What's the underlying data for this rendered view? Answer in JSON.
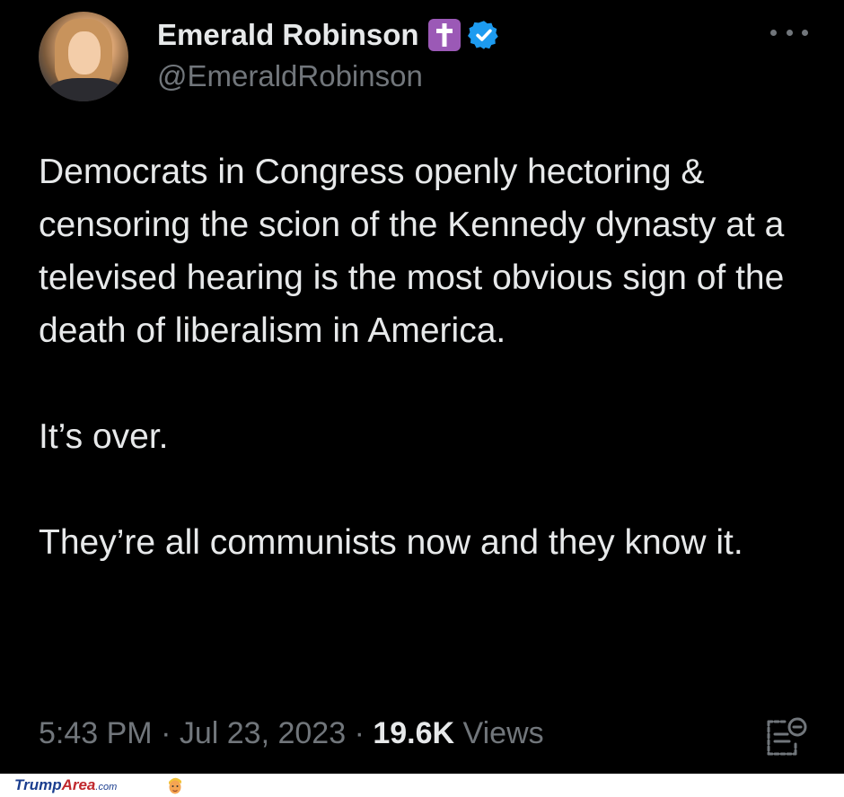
{
  "author": {
    "display_name": "Emerald Robinson",
    "handle": "@EmeraldRobinson",
    "badges": [
      "latin-cross-emoji-icon",
      "verified-badge-icon"
    ]
  },
  "tweet": {
    "paragraphs": [
      "Democrats in Congress openly hectoring & censoring the scion of the Kennedy dynasty at a televised hearing is the most obvious sign of the death of liberalism in America.",
      "It’s over.",
      "They’re all communists now and they know it."
    ],
    "time": "5:43 PM",
    "separator": "·",
    "date": "Jul 23, 2023",
    "views_count": "19.6K",
    "views_label": "Views"
  },
  "icons": {
    "more": "more-options-icon",
    "analytics": "analytics-icon"
  },
  "colors": {
    "background": "#000000",
    "primary_text": "#e7e9ea",
    "secondary_text": "#71767b",
    "verified_blue": "#1d9bf0",
    "cross_purple": "#9b59b6"
  },
  "watermark": {
    "part1": "Trump",
    "part2": "Area",
    "part3": ".com"
  }
}
